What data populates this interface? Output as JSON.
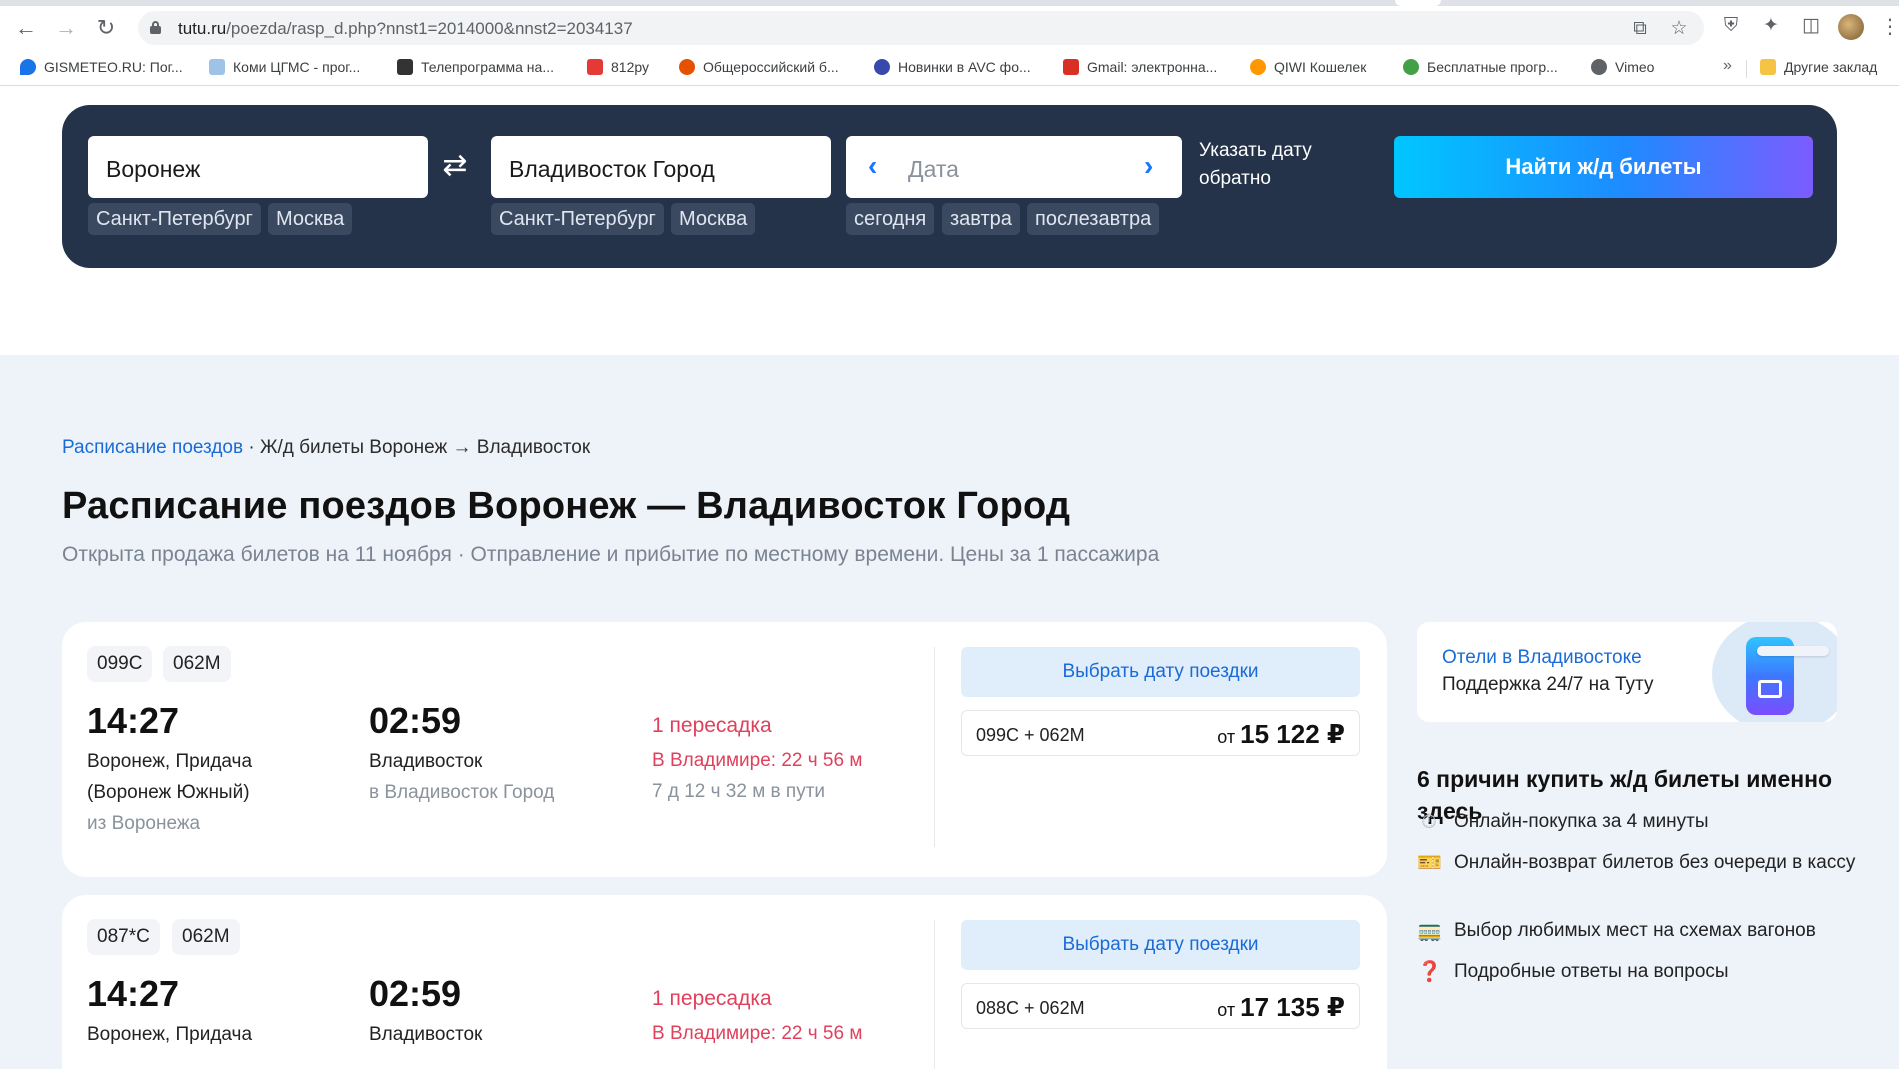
{
  "browser": {
    "url_host": "tutu.ru",
    "url_path": "/poezda/rasp_d.php?nnst1=2014000&nnst2=2034137",
    "bookmarks": [
      {
        "label": "GISMETEO.RU: Пог...",
        "icon": "water-drop-icon",
        "color": "#1a73e8"
      },
      {
        "label": "Коми ЦГМС - прог...",
        "icon": "map-icon",
        "color": "#9ec3e6"
      },
      {
        "label": "Телепрограмма на...",
        "icon": "clapper-icon",
        "color": "#333333"
      },
      {
        "label": "812ру",
        "icon": "812-icon",
        "color": "#e53935"
      },
      {
        "label": "Общероссийский б...",
        "icon": "star-burst-icon",
        "color": "#e65100"
      },
      {
        "label": "Новинки в AVC фо...",
        "icon": "flower-icon",
        "color": "#3949ab"
      },
      {
        "label": "Gmail: электронна...",
        "icon": "gmail-icon",
        "color": "#d93025"
      },
      {
        "label": "QIWI Кошелек",
        "icon": "qiwi-icon",
        "color": "#ff9800"
      },
      {
        "label": "Бесплатные прогр...",
        "icon": "apps-icon",
        "color": "#43a047"
      },
      {
        "label": "Vimeo",
        "icon": "globe-icon",
        "color": "#5f6368"
      }
    ],
    "bookmarks_more": "»",
    "other_bookmarks": "Другие заклад"
  },
  "search": {
    "from": "Воронеж",
    "to": "Владивосток Город",
    "date_placeholder": "Дата",
    "from_chips": [
      "Санкт-Петербург",
      "Москва"
    ],
    "to_chips": [
      "Санкт-Петербург",
      "Москва"
    ],
    "date_chips": [
      "сегодня",
      "завтра",
      "послезавтра"
    ],
    "return_date_link": "Указать дату обратно",
    "submit": "Найти ж/д билеты"
  },
  "breadcrumb": {
    "link": "Расписание поездов",
    "separator": " · ",
    "current": "Ж/д билеты Воронеж → Владивосток"
  },
  "heading": "Расписание поездов Воронеж — Владивосток Город",
  "subtitle": "Открыта продажа билетов на 11 ноября · Отправление и прибытие по местному времени. Цены за 1 пассажира",
  "trips": [
    {
      "trains": [
        "099С",
        "062М"
      ],
      "depart_time": "14:27",
      "depart_station_1": "Воронеж, Придача",
      "depart_station_2": "(Воронеж Южный)",
      "depart_city": "из Воронежа",
      "arrive_time": "02:59",
      "arrive_station": "Владивосток",
      "arrive_city": "в Владивосток Город",
      "transfers": "1 пересадка",
      "transfer_detail": "В Владимире: 22 ч 56 м",
      "travel_time": "7 д 12 ч 32 м в пути",
      "choose_date": "Выбрать дату поездки",
      "offer_trains": "099С + 062М",
      "price_prefix": "от",
      "price": "15 122 ₽"
    },
    {
      "trains": [
        "087*С",
        "062М"
      ],
      "depart_time": "14:27",
      "depart_station_1": "Воронеж, Придача",
      "arrive_time": "02:59",
      "arrive_station": "Владивосток",
      "transfers": "1 пересадка",
      "transfer_detail": "В Владимире: 22 ч 56 м",
      "choose_date": "Выбрать дату поездки",
      "offer_trains": "088С + 062М",
      "price_prefix": "от",
      "price": "17 135 ₽"
    }
  ],
  "aside": {
    "hotel_title": "Отели в Владивостоке",
    "hotel_sub": "Поддержка 24/7 на Туту",
    "reasons_title": "6 причин купить ж/д билеты именно здесь",
    "reasons": [
      {
        "text": "Онлайн-покупка за 4 минуты",
        "icon": "clock-icon"
      },
      {
        "text": "Онлайн-возврат билетов без очереди в кассу",
        "icon": "ticket-icon"
      },
      {
        "text": "Выбор любимых мест на схемах вагонов",
        "icon": "train-car-icon"
      },
      {
        "text": "Подробные ответы на вопросы",
        "icon": "question-icon"
      }
    ]
  }
}
